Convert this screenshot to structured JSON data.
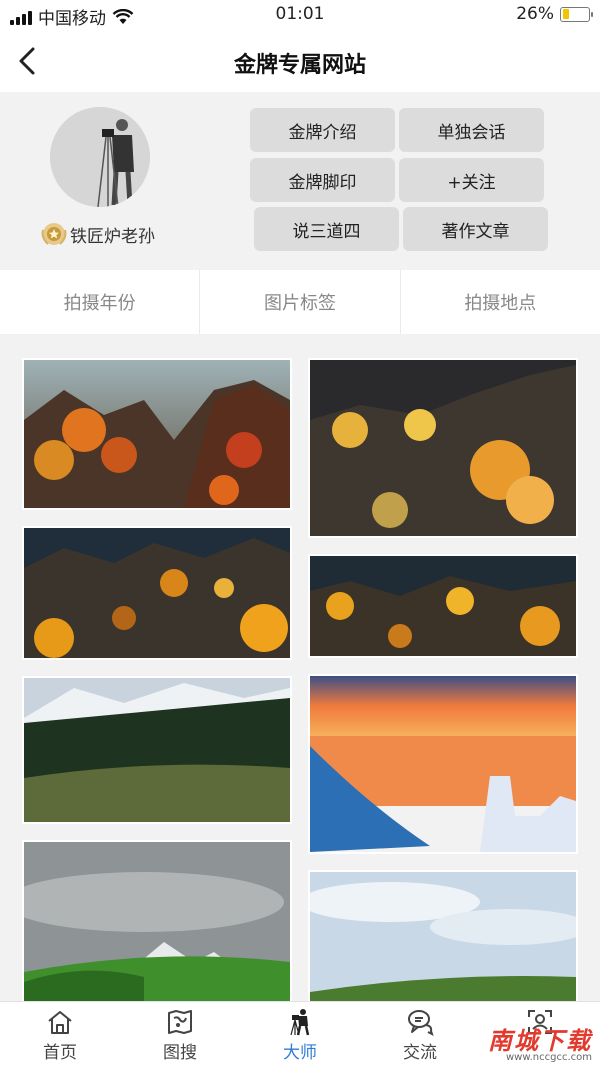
{
  "status_bar": {
    "carrier": "中国移动",
    "time": "01:01",
    "battery": "26%",
    "battery_level": 0.26
  },
  "nav": {
    "title": "金牌专属网站",
    "back_icon": "chevron-left-icon"
  },
  "profile": {
    "name": "铁匠炉老孙",
    "badge_icon": "gold-medal-icon",
    "buttons": [
      "金牌介绍",
      "单独会话",
      "金牌脚印",
      "+关注",
      "说三道四",
      "著作文章"
    ]
  },
  "filters": [
    "拍摄年份",
    "图片标签",
    "拍摄地点"
  ],
  "tabs": [
    {
      "label": "首页",
      "icon": "home-icon"
    },
    {
      "label": "图搜",
      "icon": "map-search-icon"
    },
    {
      "label": "大师",
      "icon": "photographer-icon"
    },
    {
      "label": "交流",
      "icon": "chat-icon"
    },
    {
      "label": "",
      "icon": "user-scan-icon"
    }
  ],
  "watermark": {
    "text": "南城下载",
    "url": "www.nccgcc.com"
  },
  "colors": {
    "accent": "#2f7dd6",
    "pill": "#dcdcdc",
    "watermark": "#e23b2e"
  }
}
